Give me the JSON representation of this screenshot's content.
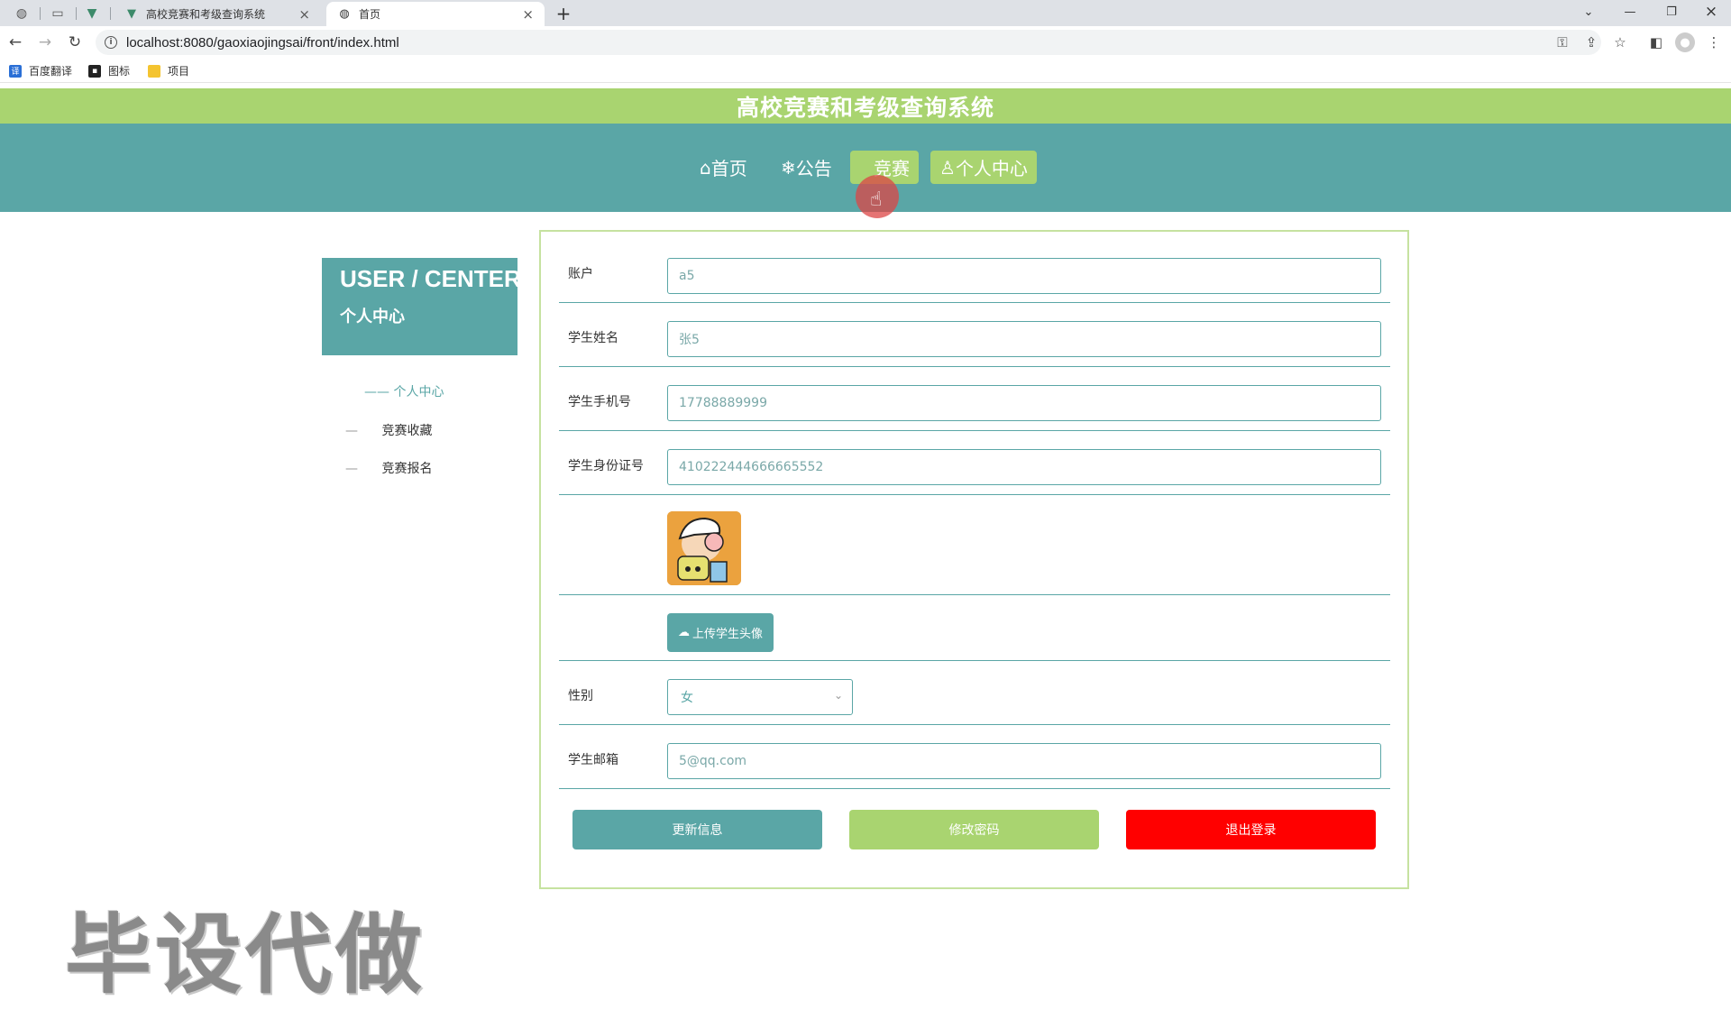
{
  "browser": {
    "tabs": [
      {
        "title": "高校竞赛和考级查询系统",
        "icon": "vue-icon"
      },
      {
        "title": "首页",
        "icon": "globe-icon"
      }
    ],
    "url": "localhost:8080/gaoxiaojingsai/front/index.html",
    "bookmarks": [
      "百度翻译",
      "图标",
      "项目"
    ]
  },
  "site": {
    "title": "高校竞赛和考级查询系统",
    "nav": [
      {
        "icon": "⌂",
        "label": "首页"
      },
      {
        "icon": "❄",
        "label": "公告"
      },
      {
        "icon": "",
        "label": "竞赛"
      },
      {
        "icon": "♙",
        "label": "个人中心"
      }
    ]
  },
  "side": {
    "title_en": "USER / CENTER",
    "title_cn": "个人中心",
    "items": [
      {
        "prefix": "——",
        "label": "个人中心"
      },
      {
        "prefix": "—",
        "label": "竞赛收藏"
      },
      {
        "prefix": "—",
        "label": "竞赛报名"
      }
    ]
  },
  "form": {
    "account_label": "账户",
    "account_value": "a5",
    "name_label": "学生姓名",
    "name_value": "张5",
    "phone_label": "学生手机号",
    "phone_value": "17788889999",
    "idcard_label": "学生身份证号",
    "idcard_value": "410222444666665552",
    "upload_label": "上传学生头像",
    "gender_label": "性别",
    "gender_value": "女",
    "email_label": "学生邮箱",
    "email_value": "5@qq.com"
  },
  "actions": {
    "update": "更新信息",
    "change_password": "修改密码",
    "logout": "退出登录"
  },
  "colors": {
    "teal": "#5aa6a6",
    "green": "#a9d470",
    "red": "#ff0000"
  },
  "watermark": "毕设代做"
}
